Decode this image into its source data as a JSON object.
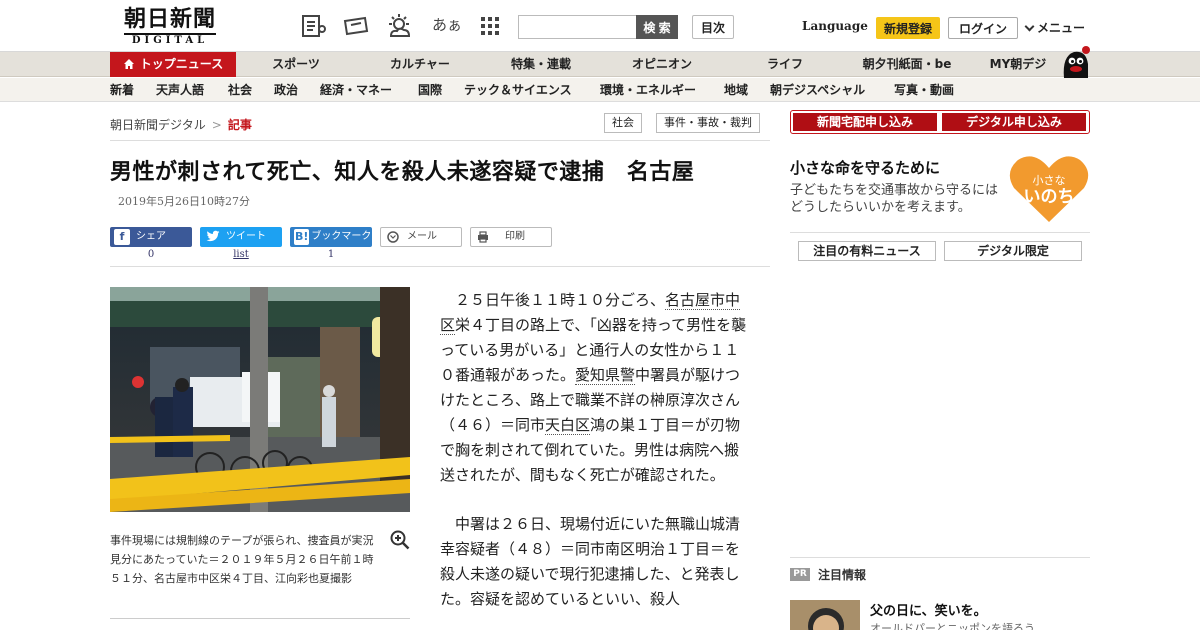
{
  "header": {
    "logo_main": "朝日新聞",
    "logo_sub": "DIGITAL",
    "font_size_label": "あぁ",
    "search_placeholder": "",
    "search_button": "検 索",
    "index_button": "目次",
    "language": "Language",
    "register": "新規登録",
    "login": "ログイン",
    "menu": "メニュー"
  },
  "categories": [
    {
      "label": "トップニュース",
      "active": true
    },
    {
      "label": "スポーツ"
    },
    {
      "label": "カルチャー"
    },
    {
      "label": "特集・連載"
    },
    {
      "label": "オピニオン"
    },
    {
      "label": "ライフ"
    },
    {
      "label": "朝夕刊紙面・be"
    },
    {
      "label": "MY朝デジ"
    }
  ],
  "subnav": [
    "新着",
    "天声人語",
    "社会",
    "政治",
    "経済・マネー",
    "国際",
    "テック＆サイエンス",
    "環境・エネルギー",
    "地域",
    "朝デジスペシャル",
    "写真・動画"
  ],
  "breadcrumb": {
    "home": "朝日新聞デジタル",
    "sep": ">",
    "current": "記事"
  },
  "tags": [
    "社会",
    "事件・事故・裁判"
  ],
  "article": {
    "headline": "男性が刺されて死亡、知人を殺人未遂容疑で逮捕　名古屋",
    "timestamp": "2019年5月26日10時27分",
    "share": {
      "facebook": {
        "label": "シェア",
        "count": "0"
      },
      "twitter": {
        "label": "ツイート",
        "count": "list"
      },
      "hatena": {
        "label": "ブックマーク",
        "count": "1"
      },
      "mail": {
        "label": "メール"
      },
      "print": {
        "label": "印刷"
      }
    },
    "caption": "事件現場には規制線のテープが張られ、捜査員が実況見分にあたっていた＝２０１９年５月２６日午前１時５１分、名古屋市中区栄４丁目、江向彩也夏撮影",
    "p1": {
      "a": "２５日午後１１時１０分ごろ、",
      "kw1": "名古屋市中区",
      "b": "栄４丁目の路上で、「凶器を持って男性を襲っている男がいる」と通行人の女性から１１０番通報があった。",
      "kw2": "愛知県警",
      "c": "中署員が駆けつけたところ、路上で職業不詳の榊原淳次さん（４６）＝同市",
      "kw3": "天白区",
      "d": "鴻の巣１丁目＝が刃物で胸を刺されて倒れていた。男性は病院へ搬送されたが、間もなく死亡が確認された。"
    },
    "p2": "中署は２６日、現場付近にいた無職山城清幸容疑者（４８）＝同市南区明治１丁目＝を殺人未遂の疑いで現行犯逮捕した、と発表した。容疑を認めているといい、殺人"
  },
  "sidebar": {
    "subscribe_paper": "新聞宅配申し込み",
    "subscribe_digital": "デジタル申し込み",
    "promo_title": "小さな命を守るために",
    "promo_text": "子どもたちを交通事故から守るにはどうしたらいいかを考えます。",
    "promo_heart_small": "小さな",
    "promo_heart_big": "いのち",
    "tab_paid": "注目の有料ニュース",
    "tab_digital": "デジタル限定",
    "pr_badge": "PR",
    "pr_title": "注目情報",
    "pr_headline": "父の日に、笑いを。",
    "pr_sub": "オールドパーとニッポンを語ろう"
  },
  "colors": {
    "brand_red": "#c4161c",
    "register_yellow": "#f5c518",
    "facebook": "#3b5998",
    "twitter": "#1da1f2",
    "hatena": "#2f7fc8"
  }
}
